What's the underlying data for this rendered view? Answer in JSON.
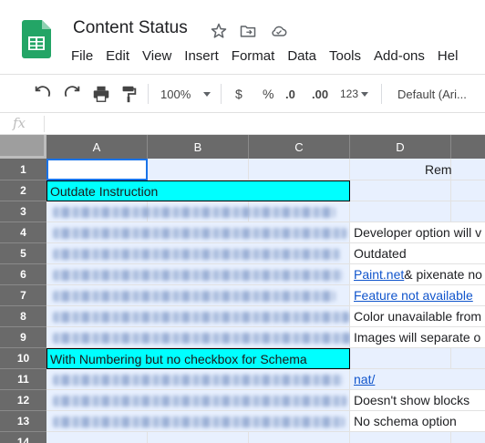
{
  "doc": {
    "title": "Content Status"
  },
  "menu": [
    "File",
    "Edit",
    "View",
    "Insert",
    "Format",
    "Data",
    "Tools",
    "Add-ons",
    "Hel"
  ],
  "toolbar": {
    "zoom": "100%",
    "currency": "$",
    "percent": "%",
    "decrease_decimal": ".0",
    "increase_decimal": ".00",
    "more_formats": "123",
    "font": "Default (Ari..."
  },
  "formula_bar": {
    "fx": "fx",
    "value": ""
  },
  "columns": [
    "A",
    "B",
    "C",
    "D"
  ],
  "rows": [
    "1",
    "2",
    "3",
    "4",
    "5",
    "6",
    "7",
    "8",
    "9",
    "10",
    "11",
    "12",
    "13",
    "14"
  ],
  "cells": {
    "d1": "Remarks",
    "a2": "Outdate Instruction",
    "d4": "Developer option will v",
    "d5": "Outdated",
    "d6_link": "Paint.net",
    "d6_rest": " & pixenate no",
    "d7_link": "Feature not available",
    "d8": "Color unavailable from",
    "d9": "Images will separate o",
    "a10": "With Numbering but no checkbox for Schema",
    "d11_link": "nat/",
    "d12": "Doesn't show blocks",
    "d13": "No schema option"
  }
}
